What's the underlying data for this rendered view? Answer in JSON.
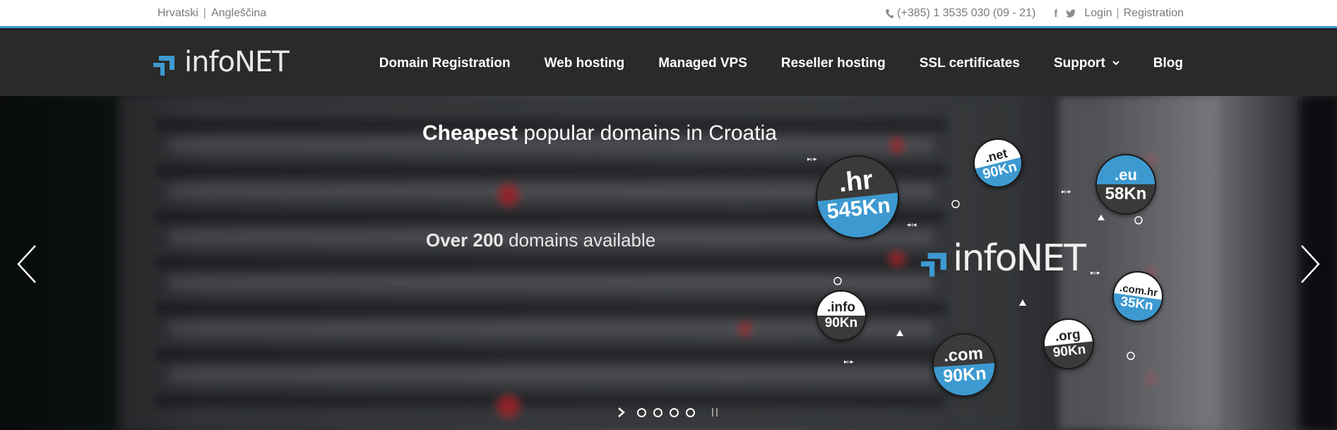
{
  "topbar": {
    "lang_hr": "Hrvatski",
    "lang_sep": "|",
    "lang_en": "Angleščina",
    "phone": "(+385) 1 3535 030 (09 - 21)",
    "social": {
      "facebook": "f",
      "twitter": "t"
    },
    "login": "Login",
    "auth_sep": "|",
    "registration": "Registration"
  },
  "logo": {
    "text": "infoNET"
  },
  "nav": {
    "items": [
      {
        "label": "Domain Registration"
      },
      {
        "label": "Web hosting"
      },
      {
        "label": "Managed VPS"
      },
      {
        "label": "Reseller hosting"
      },
      {
        "label": "SSL certificates"
      },
      {
        "label": "Support"
      },
      {
        "label": "Blog"
      }
    ]
  },
  "hero": {
    "headline_bold": "Cheapest",
    "headline_rest": " popular domains in Croatia",
    "sub_bold": "Over 200",
    "sub_rest": " domains available",
    "logo_text": "infoNET",
    "badges": [
      {
        "tld": ".hr",
        "price": "545Kn",
        "style": "blue-bottom"
      },
      {
        "tld": ".net",
        "price": "90Kn",
        "style": "blue-bottom"
      },
      {
        "tld": ".eu",
        "price": "58Kn",
        "style": "blue-top"
      },
      {
        "tld": ".info",
        "price": "90Kn",
        "style": "dark-bottom"
      },
      {
        "tld": ".com.hr",
        "price": "35Kn",
        "style": "blue-bottom"
      },
      {
        "tld": ".org",
        "price": "90Kn",
        "style": "dark-bottom"
      },
      {
        "tld": ".com",
        "price": "90Kn",
        "style": "blue-bottom"
      }
    ],
    "slider": {
      "slides": 4,
      "active": 0
    }
  },
  "colors": {
    "accent": "#3d9ad1",
    "nav_bg": "#2a2a2a",
    "badge_dark": "#3a3a3a",
    "badge_light": "#ffffff"
  }
}
